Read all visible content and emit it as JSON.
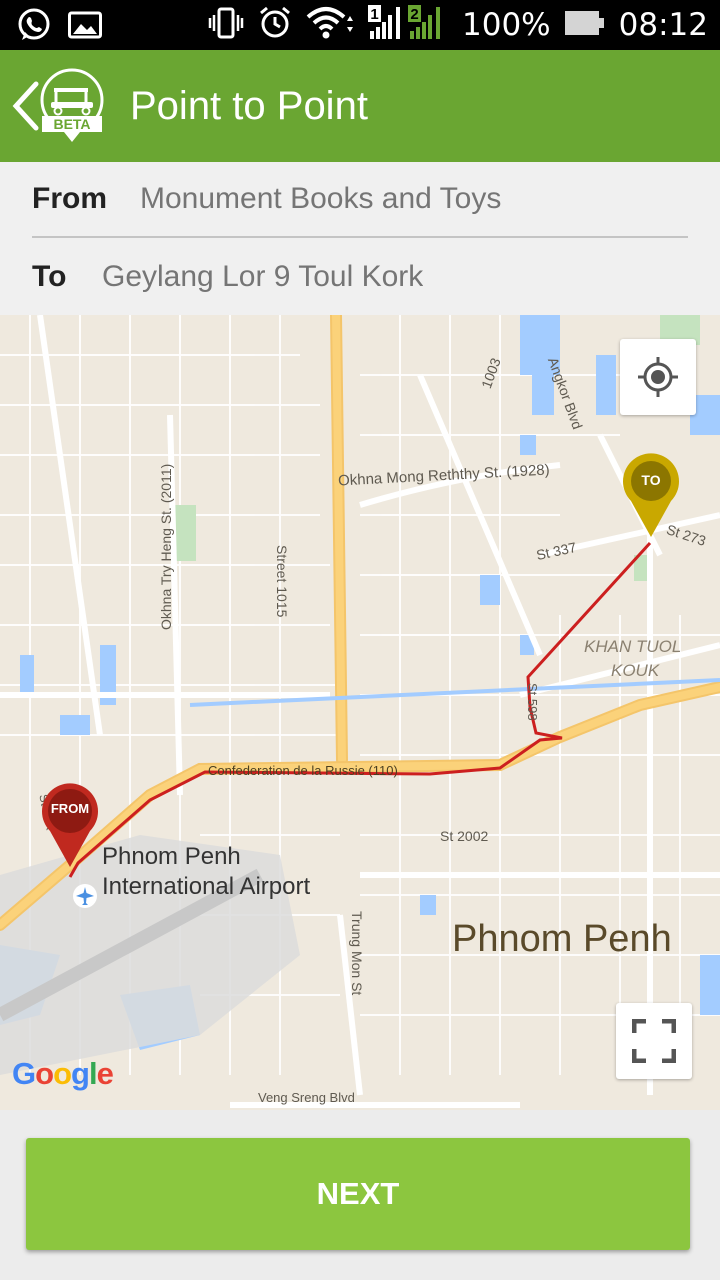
{
  "status_bar": {
    "battery_percent": "100%",
    "time": "08:12",
    "sim1": "1",
    "sim2": "2",
    "left_icons": [
      "whatsapp-icon",
      "image-icon"
    ],
    "right_icons": [
      "vibrate-icon",
      "alarm-icon",
      "wifi-icon",
      "signal-icon",
      "battery-icon"
    ]
  },
  "app_bar": {
    "title": "Point to Point",
    "logo_badge": "BETA",
    "back_icon": "chevron-left-icon",
    "color": "#6aa632"
  },
  "route": {
    "from_label": "From",
    "from_value": "Monument Books and Toys",
    "to_label": "To",
    "to_value": "Geylang Lor 9 Toul Kork"
  },
  "map": {
    "labels": {
      "okhna_mong": "Okhna Mong Reththy St. (1928)",
      "street_1015": "Street 1015",
      "okhna_try": "Okhna Try Heng St. (2011)",
      "angkor": "Angkor Blvd",
      "s1003": "1003",
      "st337": "St 337",
      "st273": "St 273",
      "khan_tuol_kouk_1": "KHAN TUOL",
      "khan_tuol_kouk_2": "KOUK",
      "st598": "St 598",
      "confederation": "Confederation de la Russie (110)",
      "st_lower_left": "St 10K",
      "airport_1": "Phnom Penh",
      "airport_2": "International Airport",
      "st2002": "St 2002",
      "trung_mon": "Trung Mon St",
      "phnom_penh": "Phnom Penh",
      "veng_sreng": "Veng Sreng Blvd"
    },
    "from_pin": "FROM",
    "to_pin": "TO",
    "google": [
      "G",
      "o",
      "o",
      "g",
      "l",
      "e"
    ],
    "colors": {
      "from_pin": "#c0291f",
      "to_pin": "#c9a800",
      "route": "#cc1f1f",
      "water": "#a3ccff",
      "park": "#c5e3bf",
      "major_road": "#fbd27a"
    },
    "controls": {
      "locate": "my-location-icon",
      "fullscreen": "fullscreen-icon"
    }
  },
  "bottom": {
    "next_label": "NEXT"
  }
}
